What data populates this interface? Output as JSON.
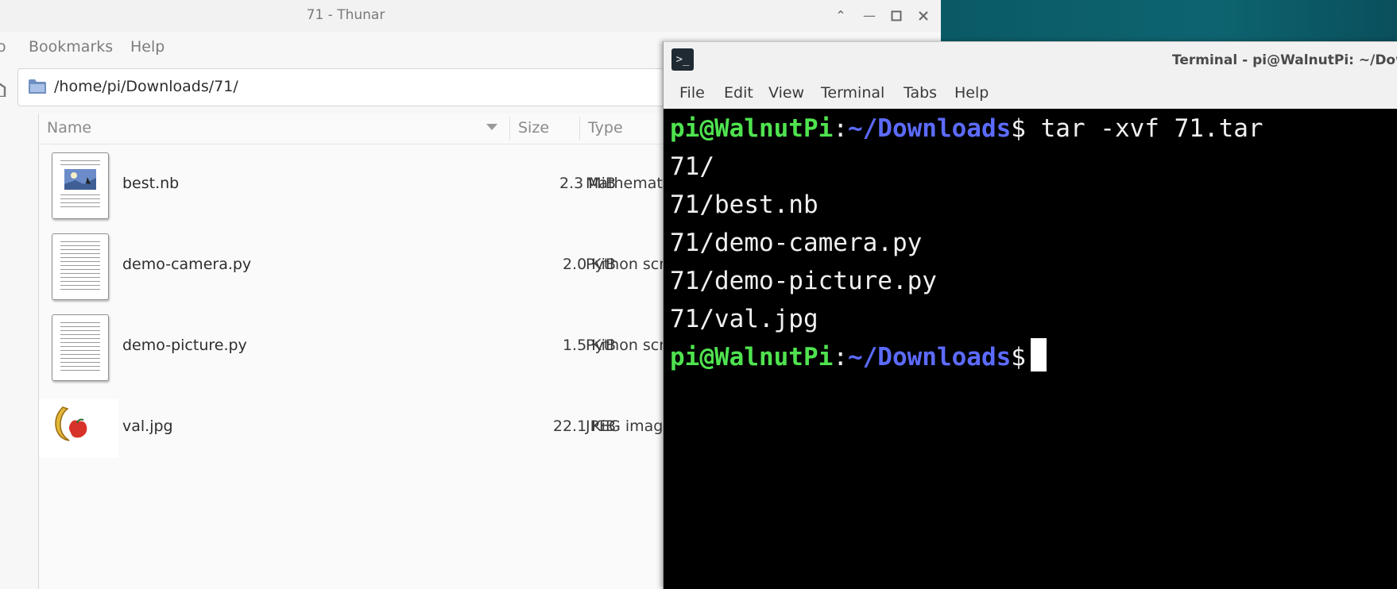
{
  "thunar": {
    "title": "71 - Thunar",
    "menu": [
      "o",
      "Bookmarks",
      "Help"
    ],
    "path": "/home/pi/Downloads/71/",
    "columns": {
      "name": "Name",
      "size": "Size",
      "type": "Type"
    },
    "files": [
      {
        "name": "best.nb",
        "size": "2.3 MiB",
        "type": "Mathemat",
        "icon": "image-document-icon"
      },
      {
        "name": "demo-camera.py",
        "size": "2.0 KiB",
        "type": "Python scr",
        "icon": "text-document-icon"
      },
      {
        "name": "demo-picture.py",
        "size": "1.5 KiB",
        "type": "Python scr",
        "icon": "text-document-icon"
      },
      {
        "name": "val.jpg",
        "size": "22.1 KiB",
        "type": "JPEG image",
        "icon": "image-thumbnail-icon"
      }
    ]
  },
  "terminal": {
    "title": "Terminal - pi@WalnutPi: ~/Down",
    "menu": [
      "File",
      "Edit",
      "View",
      "Terminal",
      "Tabs",
      "Help"
    ],
    "prompt_user": "pi@WalnutPi",
    "prompt_sep": ":",
    "prompt_path": "~/Downloads",
    "prompt_dollar": "$",
    "command": " tar -xvf 71.tar",
    "output": [
      "71/",
      "71/best.nb",
      "71/demo-camera.py",
      "71/demo-picture.py",
      "71/val.jpg"
    ]
  },
  "colors": {
    "prompt_user": "#4fe34f",
    "prompt_path": "#5c6bff",
    "terminal_bg": "#000000",
    "desktop": "#0d6470"
  }
}
